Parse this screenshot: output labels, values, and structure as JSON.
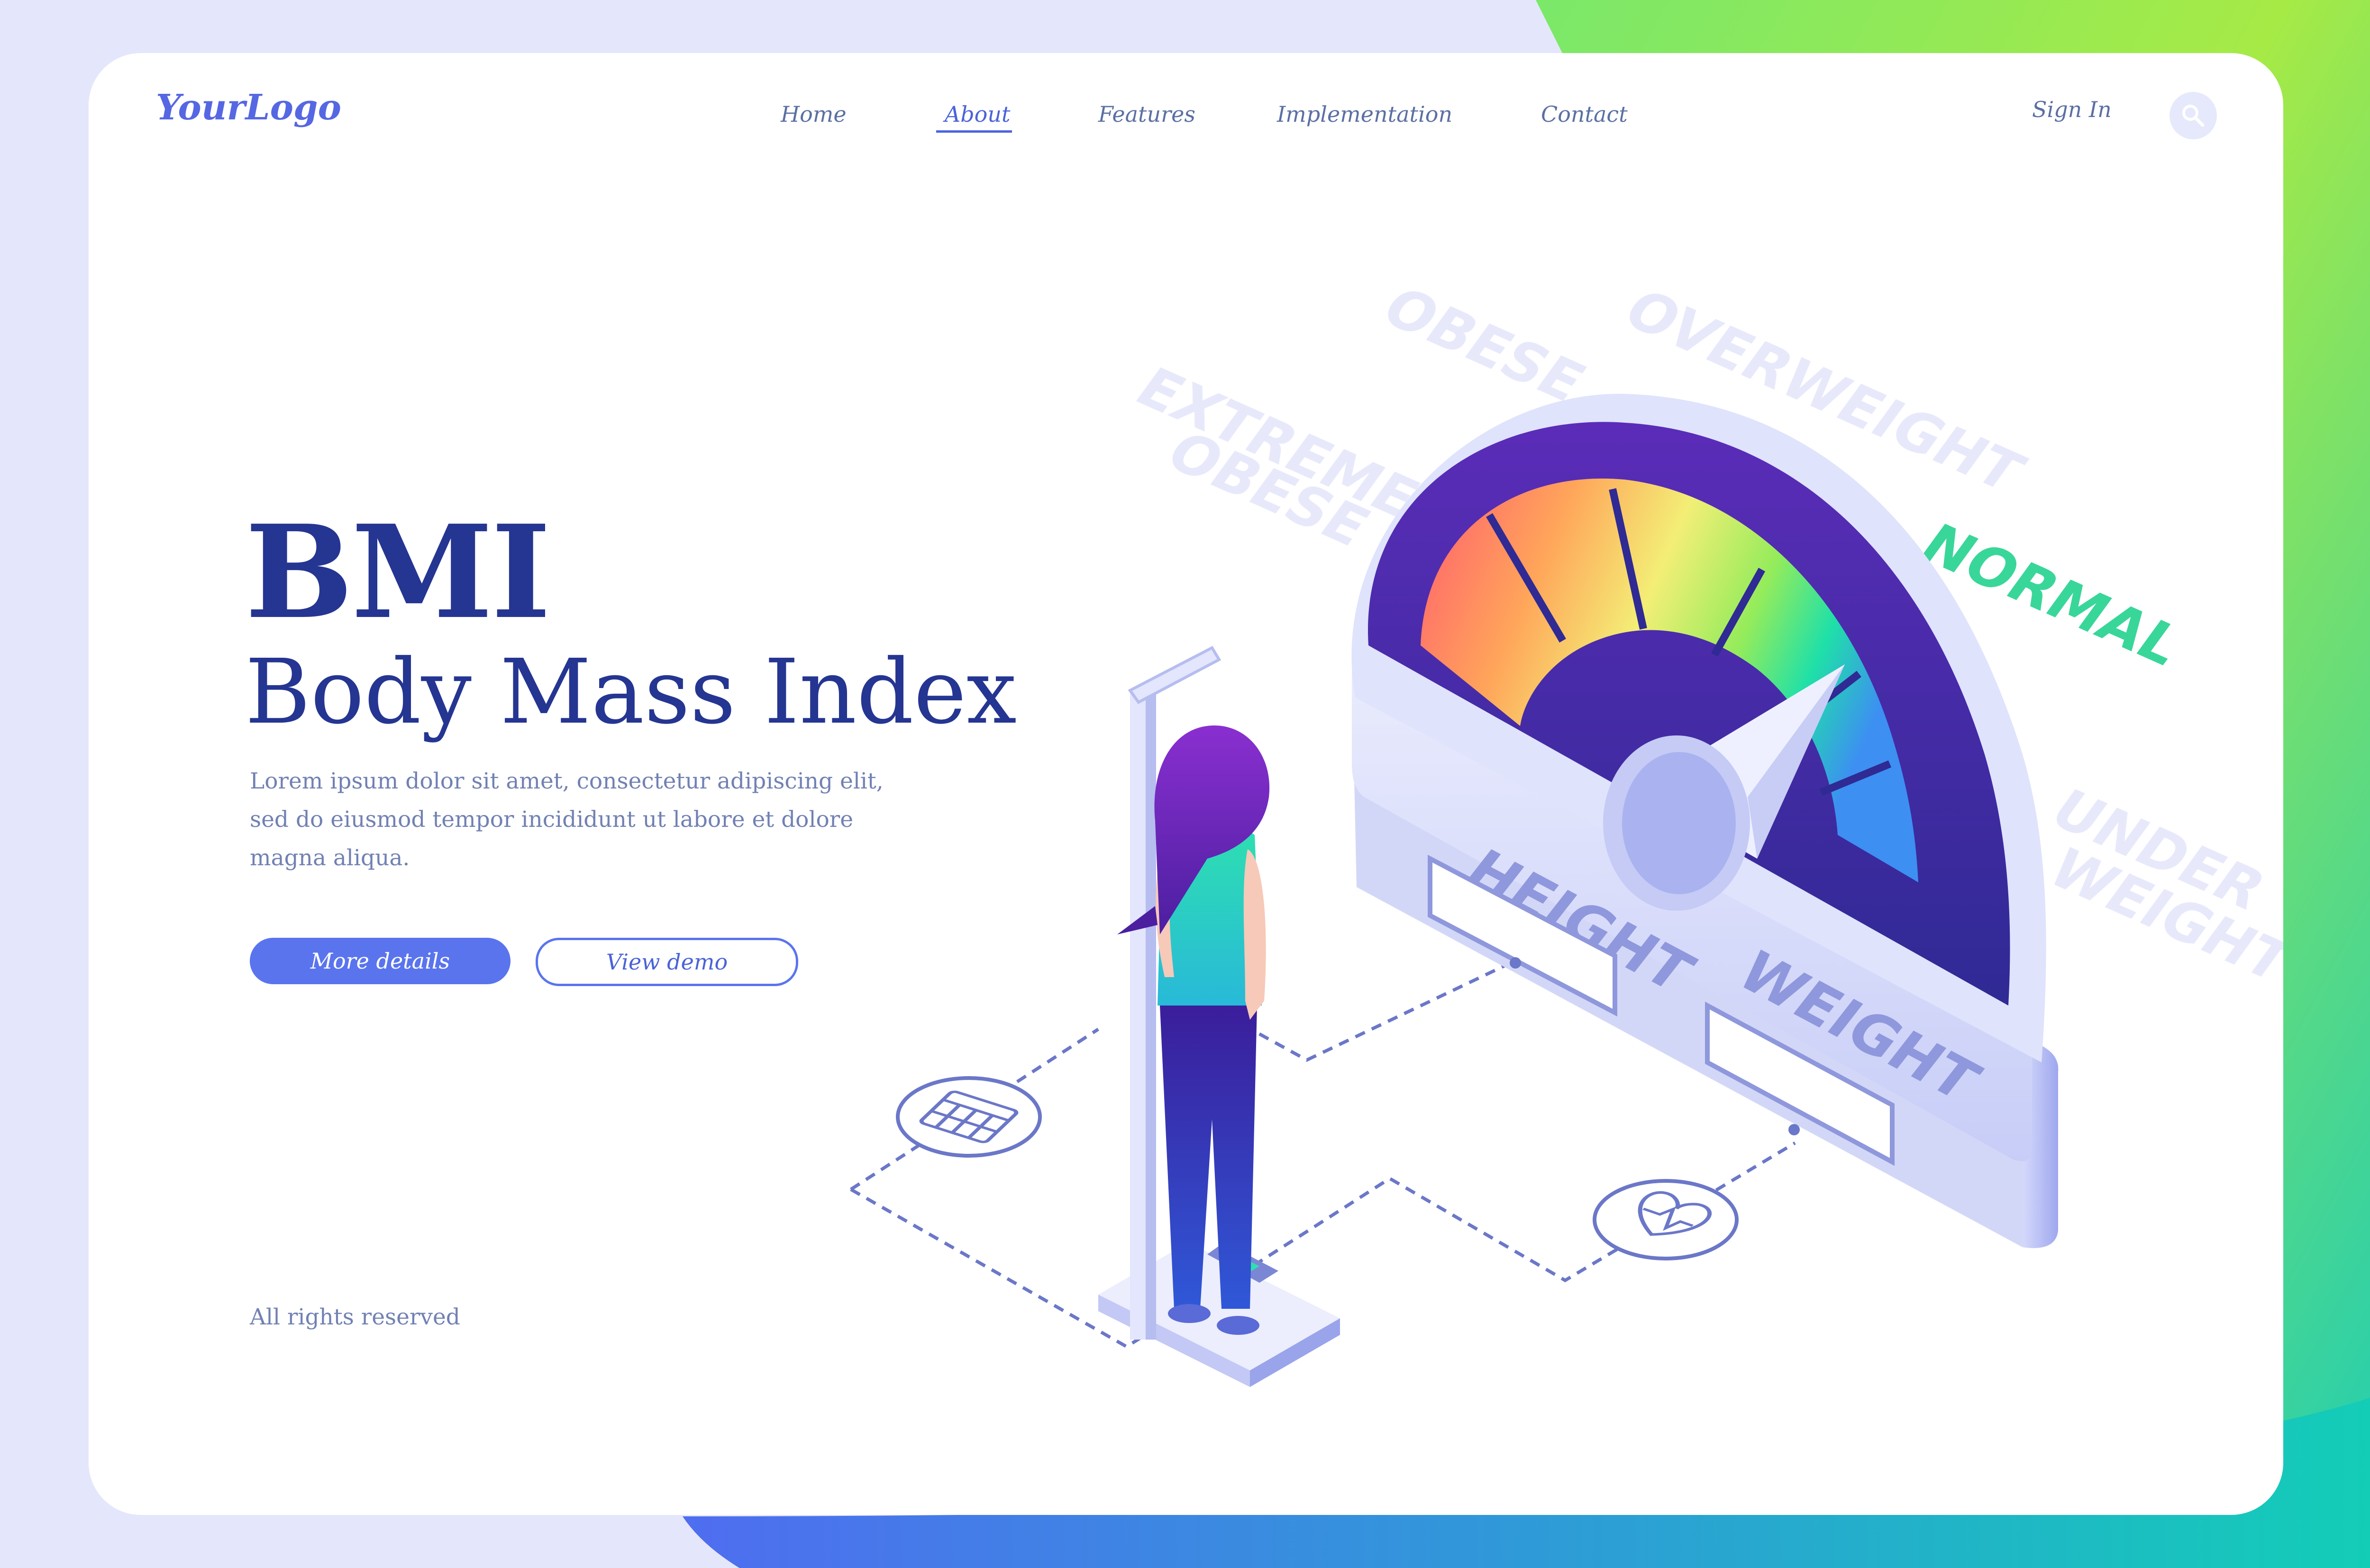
{
  "header": {
    "logo": "YourLogo",
    "nav": [
      "Home",
      "About",
      "Features",
      "Implementation",
      "Contact"
    ],
    "active_nav": "About",
    "sign_in": "Sign In",
    "search_icon": "search-icon"
  },
  "hero": {
    "title": "BMI",
    "subtitle": "Body Mass Index",
    "description": "Lorem ipsum dolor sit amet, consectetur adipiscing elit, sed do eiusmod tempor incididunt ut labore et dolore magna aliqua.",
    "primary_button": "More details",
    "secondary_button": "View demo"
  },
  "footer": {
    "copyright": "All rights reserved"
  },
  "illustration": {
    "categories": {
      "extremely_obese_1": "EXTREMELY",
      "extremely_obese_2": "OBESE",
      "obese": "OBESE",
      "overweight": "OVERWEIGHT",
      "normal": "NORMAL",
      "underweight_1": "UNDER",
      "underweight_2": "WEIGHT"
    },
    "height_label": "HEIGHT",
    "weight_label": "WEIGHT",
    "gauge_reading": "NORMAL",
    "icons": [
      "calendar-icon",
      "heart-scale-icon"
    ]
  },
  "colors": {
    "primary": "#5a74ee",
    "heading": "#253592",
    "normal": "#3ad89a",
    "gradient_green": "#9be74c",
    "gradient_teal": "#17cbb0"
  }
}
